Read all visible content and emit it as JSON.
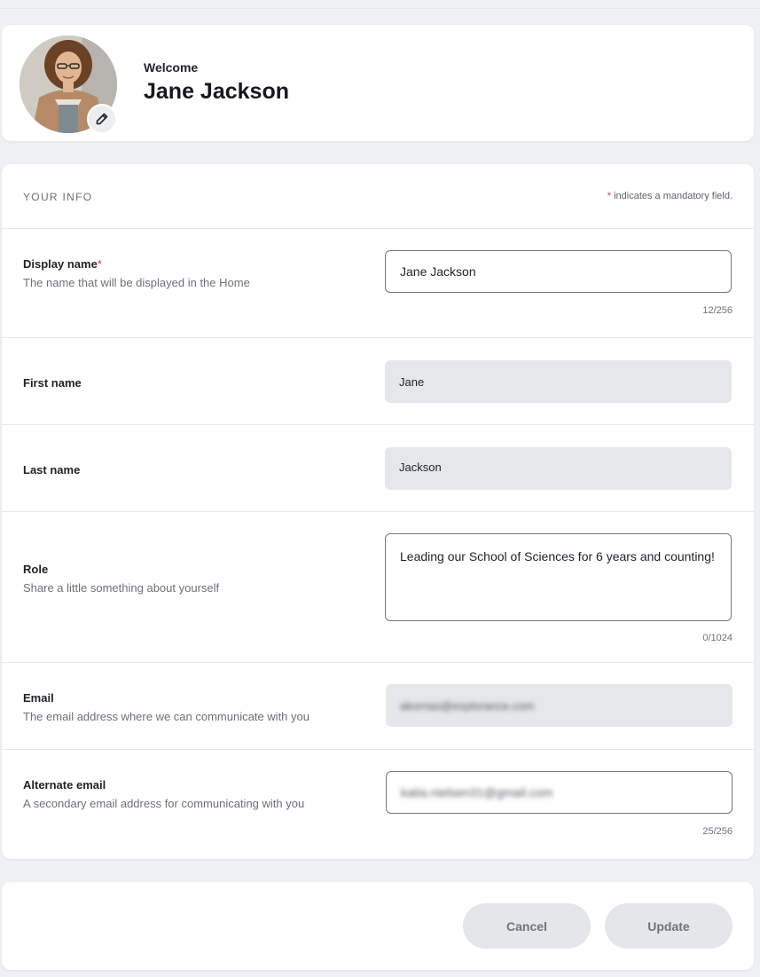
{
  "header": {
    "welcome_label": "Welcome",
    "user_name": "Jane Jackson"
  },
  "section": {
    "title": "YOUR INFO",
    "mandatory_star": "*",
    "mandatory_note": " indicates a mandatory field."
  },
  "fields": {
    "display_name": {
      "label": "Display name",
      "required_mark": "*",
      "description": "The name that will be displayed in the Home",
      "value": "Jane Jackson",
      "counter": "12/256"
    },
    "first_name": {
      "label": "First name",
      "value": "Jane"
    },
    "last_name": {
      "label": "Last name",
      "value": "Jackson"
    },
    "role": {
      "label": "Role",
      "description": "Share a little something about yourself",
      "value": "Leading our School of Sciences for 6 years and counting!",
      "counter": "0/1024"
    },
    "email": {
      "label": "Email",
      "description": "The email address where we can communicate with you",
      "value": "akornas@explorance.com"
    },
    "alternate_email": {
      "label": "Alternate email",
      "description": "A secondary email address for communicating with you",
      "value": "katia.nielsen31@gmail.com",
      "counter": "25/256"
    }
  },
  "actions": {
    "cancel_label": "Cancel",
    "update_label": "Update"
  },
  "colors": {
    "page_bg": "#eef0f3",
    "card_bg": "#ffffff",
    "required": "#c2402f",
    "readonly_field": "#e5e7ea",
    "button_bg": "#e4e6e9"
  },
  "icons": {
    "edit": "pencil-icon"
  }
}
